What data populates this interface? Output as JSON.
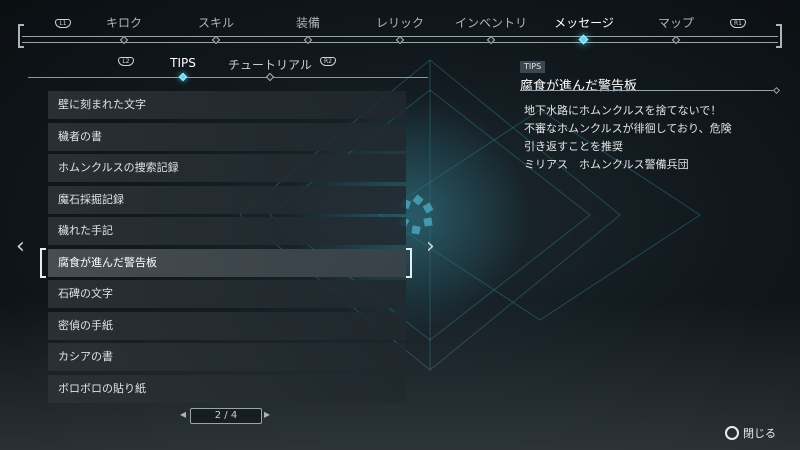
{
  "nav": {
    "left_button": "L1",
    "right_button": "R1",
    "tabs": [
      {
        "label": "キロク"
      },
      {
        "label": "スキル"
      },
      {
        "label": "装備"
      },
      {
        "label": "レリック"
      },
      {
        "label": "インベントリ"
      },
      {
        "label": "メッセージ"
      },
      {
        "label": "マップ"
      }
    ],
    "active_tab": "メッセージ"
  },
  "sub_tabs": {
    "left_button": "L2",
    "right_button": "R2",
    "tabs": [
      {
        "label": "TIPS"
      },
      {
        "label": "チュートリアル"
      }
    ],
    "active": "TIPS"
  },
  "list": {
    "items": [
      {
        "label": "壁に刻まれた文字"
      },
      {
        "label": "穢者の書"
      },
      {
        "label": "ホムンクルスの捜索記録"
      },
      {
        "label": "魔石採掘記録"
      },
      {
        "label": "穢れた手記"
      },
      {
        "label": "腐食が進んだ警告板"
      },
      {
        "label": "石碑の文字"
      },
      {
        "label": "密偵の手紙"
      },
      {
        "label": "カシアの書"
      },
      {
        "label": "ボロボロの貼り紙"
      }
    ],
    "selected_index": 5,
    "page": "2 / 4"
  },
  "detail": {
    "tag": "TIPS",
    "title": "腐食が進んだ警告板",
    "lines": [
      "地下水路にホムンクルスを捨てないで！",
      "不審なホムンクルスが徘徊しており、危険",
      "引き返すことを推奨",
      "ミリアス　ホムンクルス警備兵団"
    ]
  },
  "footer": {
    "close_label": "閉じる",
    "close_icon": "circle-button-icon"
  },
  "colors": {
    "accent": "#5ed8ef",
    "background": "#0d1216"
  }
}
